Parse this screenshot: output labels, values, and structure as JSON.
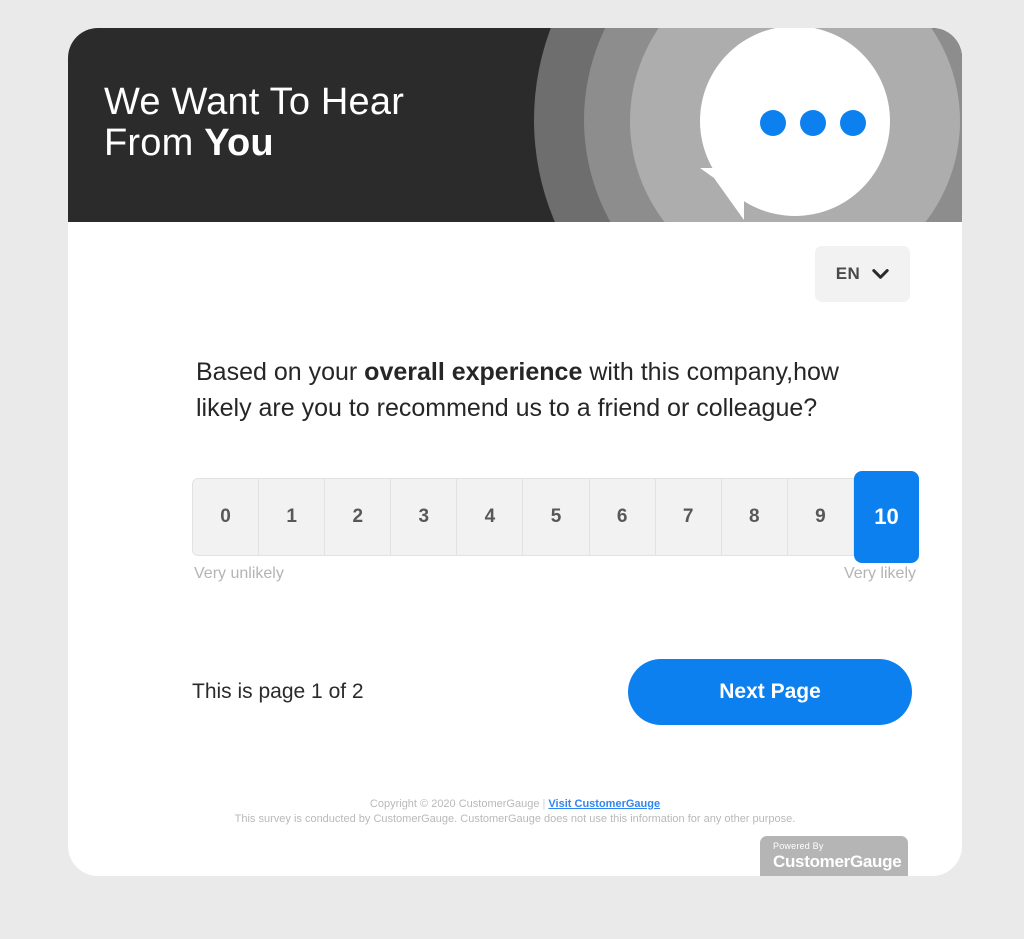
{
  "theme": {
    "accent": "#0d80ef",
    "header_bg": "#2b2b2b",
    "page_bg": "#eaeaea",
    "card_bg": "#ffffff"
  },
  "header": {
    "title_line1": "We Want To Hear",
    "title_line2_plain": "From ",
    "title_line2_bold": "You",
    "bubble_icon": "speech-bubble-icon",
    "dots_count": 3
  },
  "language": {
    "selected": "EN",
    "chevron_icon": "chevron-down-icon"
  },
  "question": {
    "part1": "Based on your ",
    "emphasis": "overall experience",
    "part2": " with this company,how likely are you to recommend us to a friend or colleague?"
  },
  "scale": {
    "options": [
      "0",
      "1",
      "2",
      "3",
      "4",
      "5",
      "6",
      "7",
      "8",
      "9",
      "10"
    ],
    "selected": "10",
    "low_label": "Very unlikely",
    "high_label": "Very likely"
  },
  "nav": {
    "page_indicator": "This is page 1 of 2",
    "next_label": "Next Page"
  },
  "footer": {
    "copyright": "Copyright © 2020 CustomerGauge",
    "separator": "|",
    "link_text": "Visit CustomerGauge",
    "disclaimer": "This survey is conducted by CustomerGauge. CustomerGauge does not use this information for any other purpose.",
    "badge_top": "Powered By",
    "badge_bottom": "CustomerGauge"
  }
}
